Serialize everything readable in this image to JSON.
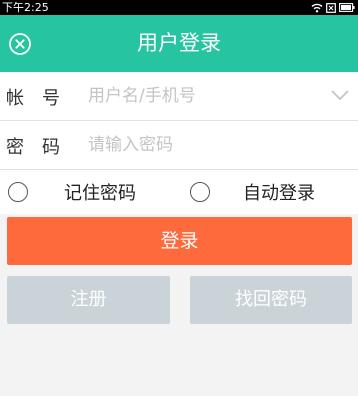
{
  "status_bar": {
    "time": "下午2:25",
    "icons": [
      "wifi-icon",
      "sim-icon",
      "battery-icon"
    ]
  },
  "title_bar": {
    "title": "用户登录",
    "close_icon": "close-circle-icon"
  },
  "form": {
    "account": {
      "label_1": "帐",
      "label_2": "号",
      "placeholder": "用户名/手机号",
      "value": "",
      "dropdown_icon": "chevron-down-icon"
    },
    "password": {
      "label_1": "密",
      "label_2": "码",
      "placeholder": "请输入密码",
      "value": ""
    }
  },
  "options": {
    "remember_password": "记住密码",
    "auto_login": "自动登录"
  },
  "buttons": {
    "login": "登录",
    "register": "注册",
    "find_password": "找回密码"
  },
  "colors": {
    "accent": "#26c4a0",
    "login_button": "#ff6a3d",
    "secondary_button": "#c9d3d8"
  }
}
